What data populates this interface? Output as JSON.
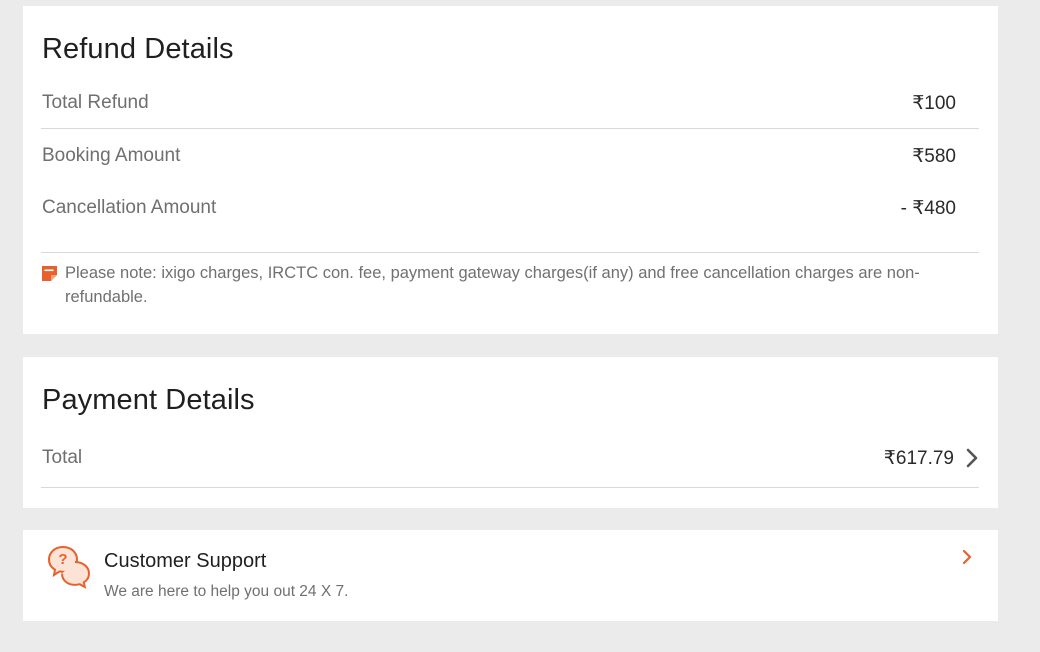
{
  "refund": {
    "title": "Refund Details",
    "total_label": "Total Refund",
    "total_value": "₹100",
    "booking_label": "Booking Amount",
    "booking_value": "₹580",
    "cancellation_label": "Cancellation Amount",
    "cancellation_value": "- ₹480",
    "note_icon": "sticky-note-icon",
    "note": "Please note: ixigo charges, IRCTC con. fee, payment gateway charges(if any) and free cancellation charges are non-refundable."
  },
  "payment": {
    "title": "Payment Details",
    "total_label": "Total",
    "total_value": "₹617.79",
    "chevron_icon": "chevron-right-icon"
  },
  "support": {
    "title": "Customer Support",
    "subtitle": "We are here to help you out 24 X 7.",
    "icon": "help-chat-icon",
    "chevron_icon": "chevron-right-icon"
  },
  "colors": {
    "accent": "#e8612c",
    "background": "#ebebeb",
    "card": "#ffffff",
    "muted_text": "#707070"
  }
}
